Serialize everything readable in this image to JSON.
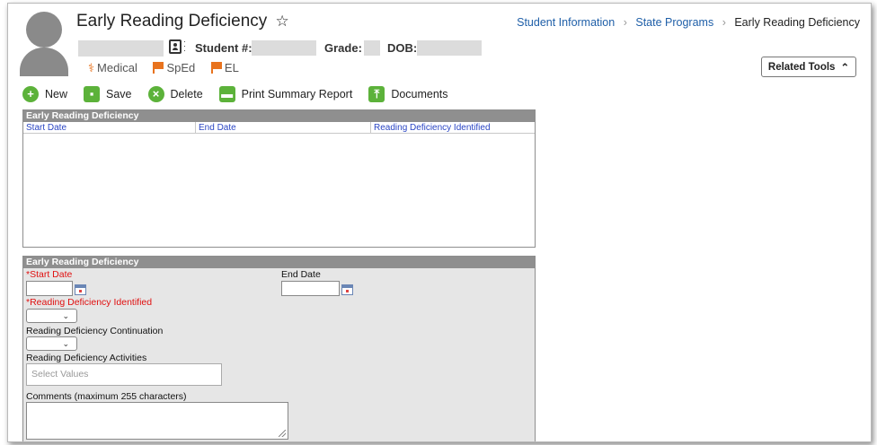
{
  "header": {
    "title": "Early Reading Deficiency",
    "breadcrumb": [
      "Student Information",
      "State Programs",
      "Early Reading Deficiency"
    ],
    "student_label": "Student #:",
    "grade_label": "Grade:",
    "dob_label": "DOB:",
    "flags": [
      "Medical",
      "SpEd",
      "EL"
    ],
    "related_tools": "Related Tools"
  },
  "toolbar": {
    "new": "New",
    "save": "Save",
    "delete": "Delete",
    "print": "Print Summary Report",
    "documents": "Documents"
  },
  "list_panel": {
    "title": "Early Reading Deficiency",
    "columns": [
      "Start Date",
      "End Date",
      "Reading Deficiency Identified"
    ]
  },
  "detail_panel": {
    "title": "Early Reading Deficiency",
    "start_date_label": "*Start Date",
    "end_date_label": "End Date",
    "identified_label": "*Reading Deficiency Identified",
    "continuation_label": "Reading Deficiency Continuation",
    "activities_label": "Reading Deficiency Activities",
    "activities_placeholder": "Select Values",
    "comments_label": "Comments (maximum 255 characters)"
  },
  "colors": {
    "accent_green": "#5cb23a",
    "flag_orange": "#e8731e",
    "link_blue": "#1f5fa8",
    "required_red": "#e01010",
    "panel_header": "#8f8f8f"
  }
}
